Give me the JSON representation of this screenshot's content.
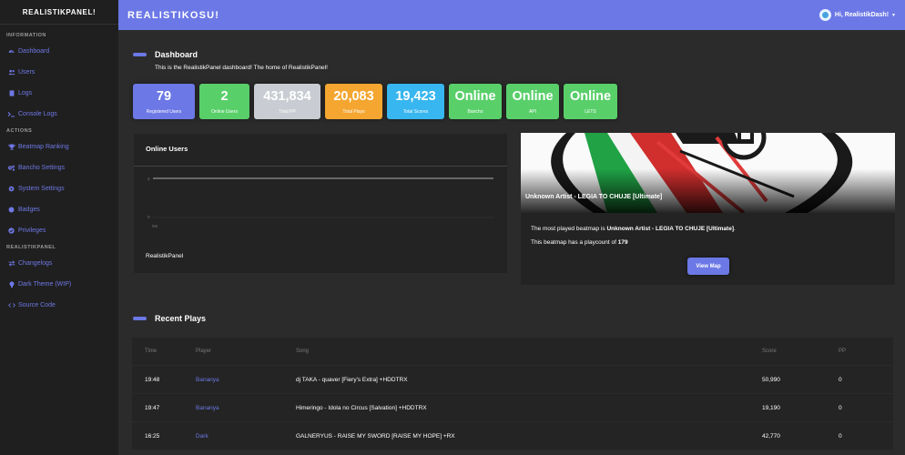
{
  "sidebar": {
    "brand": "REALISTIKPANEL!",
    "sections": [
      {
        "title": "INFORMATION",
        "items": [
          {
            "label": "Dashboard",
            "icon": "dashboard-icon"
          },
          {
            "label": "Users",
            "icon": "users-icon"
          },
          {
            "label": "Logs",
            "icon": "logs-icon"
          },
          {
            "label": "Console Logs",
            "icon": "terminal-icon"
          }
        ]
      },
      {
        "title": "ACTIONS",
        "items": [
          {
            "label": "Beatmap Ranking",
            "icon": "trophy-icon"
          },
          {
            "label": "Bancho Settings",
            "icon": "cogs-icon"
          },
          {
            "label": "System Settings",
            "icon": "gear-icon"
          },
          {
            "label": "Badges",
            "icon": "circle-icon"
          },
          {
            "label": "Privileges",
            "icon": "check-circle-icon"
          }
        ]
      },
      {
        "title": "REALISTIKPANEL",
        "items": [
          {
            "label": "Changelogs",
            "icon": "exchange-icon"
          },
          {
            "label": "Dark Theme (WIP)",
            "icon": "lightbulb-icon"
          },
          {
            "label": "Source Code",
            "icon": "code-icon"
          }
        ]
      }
    ]
  },
  "topbar": {
    "title": "REALISTIKOSU!",
    "user": "Hi, RealistikDash!"
  },
  "dashboard": {
    "heading": "Dashboard",
    "subtitle": "This is the RealistikPanel dashboard! The home of RealistikPanel!",
    "stats": [
      {
        "value": "79",
        "label": "Registered Users",
        "color": "#6c78e6"
      },
      {
        "value": "2",
        "label": "Online Users",
        "color": "#59cf6a"
      },
      {
        "value": "431,834",
        "label": "Total PP",
        "color": "#c9ccd3"
      },
      {
        "value": "20,083",
        "label": "Total Plays",
        "color": "#f4a630"
      },
      {
        "value": "19,423",
        "label": "Total Scores",
        "color": "#37b6ef"
      },
      {
        "value": "Online",
        "label": "Bancho",
        "color": "#59cf6a"
      },
      {
        "value": "Online",
        "label": "API",
        "color": "#59cf6a"
      },
      {
        "value": "Online",
        "label": "LETS",
        "color": "#59cf6a"
      }
    ]
  },
  "online_users": {
    "title": "Online Users",
    "y_tick_top": "2",
    "y_tick_bottom": "0",
    "x_tick": "0m",
    "legend": "RealistikPanel"
  },
  "beatmap": {
    "title": "Unknown Artist - LEGIA TO CHUJE [Ultimate]",
    "line1_prefix": "The most played beatmap is ",
    "line1_bold": "Unknown Artist - LEGIA TO CHUJE [Ultimate]",
    "line1_suffix": ".",
    "line2_prefix": "This beatmap has a playcount of ",
    "line2_bold": "179",
    "button": "View Map"
  },
  "recent": {
    "heading": "Recent Plays",
    "columns": {
      "time": "Time",
      "player": "Player",
      "song": "Song",
      "score": "Score",
      "pp": "PP"
    },
    "rows": [
      {
        "time": "19:48",
        "player": "Bananya",
        "song": "dj TAKA - quaver [Fiery's Extra] +HDDTRX",
        "score": "50,990",
        "pp": "0"
      },
      {
        "time": "19:47",
        "player": "Bananya",
        "song": "Himeringo - Idola no Circus [Salvation] +HDDTRX",
        "score": "19,190",
        "pp": "0"
      },
      {
        "time": "16:25",
        "player": "Dark",
        "song": "GALNERYUS - RAISE MY SWORD [RAISE MY HOPE] +RX",
        "score": "42,770",
        "pp": "0"
      }
    ]
  },
  "chart_data": {
    "type": "line",
    "x": [
      "0m"
    ],
    "series": [
      {
        "name": "RealistikPanel",
        "values": [
          2
        ]
      }
    ],
    "ylim": [
      0,
      2
    ]
  }
}
